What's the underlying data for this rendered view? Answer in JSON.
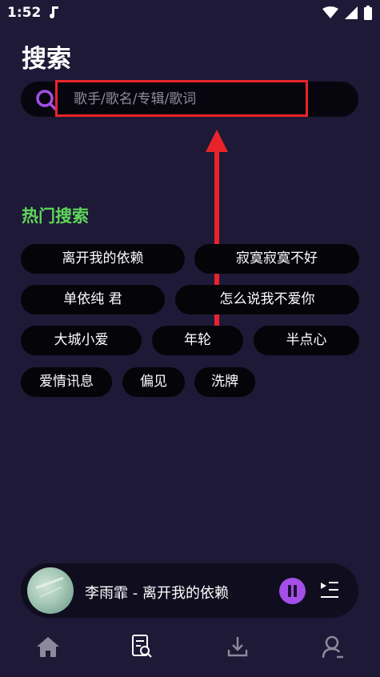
{
  "status_bar": {
    "time": "1:52"
  },
  "page": {
    "title": "搜索"
  },
  "search": {
    "placeholder": "歌手/歌名/专辑/歌词"
  },
  "hot_search": {
    "title": "热门搜索",
    "items": [
      "离开我的依赖",
      "寂寞寂寞不好",
      "单依纯 君",
      "怎么说我不爱你",
      "大城小爱",
      "年轮",
      "半点心",
      "爱情讯息",
      "偏见",
      "洗牌"
    ]
  },
  "mini_player": {
    "now_playing": "李雨霏 - 离开我的依赖"
  },
  "bottom_nav": {
    "items": [
      "home-icon",
      "search-list-icon",
      "download-icon",
      "profile-icon"
    ]
  },
  "colors": {
    "background": "#1d1936",
    "accent": "#a34fe8",
    "hot_title": "#5fd65b",
    "annotation": "#e8242a"
  }
}
